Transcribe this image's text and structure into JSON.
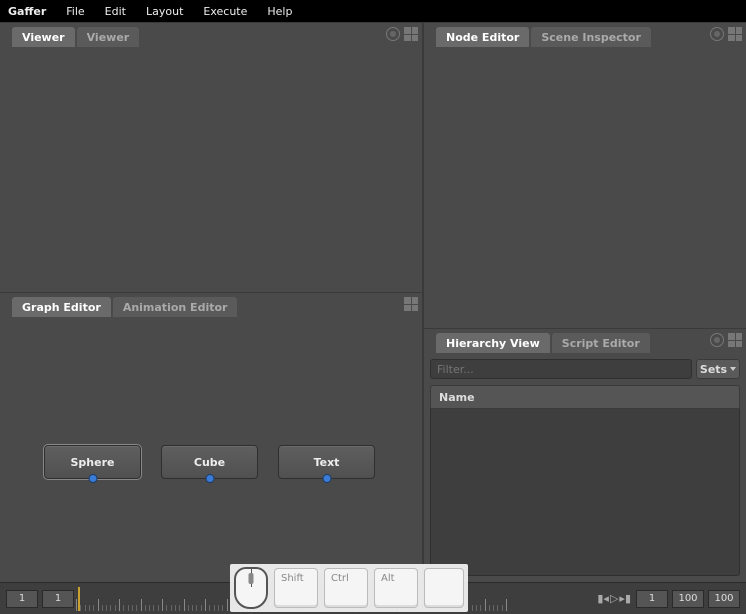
{
  "app_name": "Gaffer",
  "menu": {
    "file": "File",
    "edit": "Edit",
    "layout": "Layout",
    "execute": "Execute",
    "help": "Help"
  },
  "panels": {
    "viewer": {
      "tab_active": "Viewer",
      "tab_inactive": "Viewer"
    },
    "node_editor": {
      "tab_active": "Node Editor",
      "tab_inactive": "Scene Inspector"
    },
    "graph_editor": {
      "tab_active": "Graph Editor",
      "tab_inactive": "Animation Editor"
    },
    "hierarchy": {
      "tab_active": "Hierarchy View",
      "tab_inactive": "Script Editor",
      "filter_placeholder": "Filter...",
      "sets_label": "Sets",
      "name_header": "Name"
    }
  },
  "nodes": [
    {
      "label": "Sphere"
    },
    {
      "label": "Cube"
    },
    {
      "label": "Text"
    }
  ],
  "timeline": {
    "start_range": "1",
    "start_frame": "1",
    "current_frame": "1",
    "end_frame": "100",
    "end_range": "100"
  },
  "overlay_keys": {
    "shift": "Shift",
    "ctrl": "Ctrl",
    "alt": "Alt"
  }
}
